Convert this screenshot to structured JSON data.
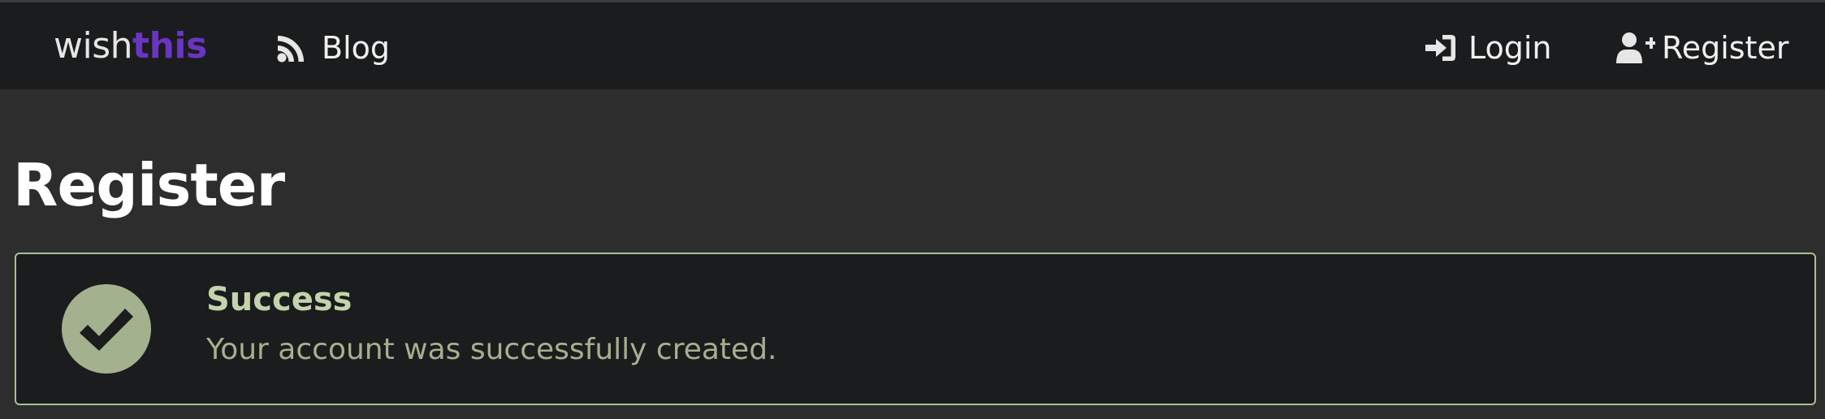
{
  "navbar": {
    "brand_part1": "wish",
    "brand_part2": "this",
    "blog_label": "Blog",
    "login_label": "Login",
    "register_label": "Register",
    "brand_accent_color": "#6a35c3",
    "icons": {
      "blog": "rss-icon",
      "login": "sign-in-icon",
      "register": "user-plus-icon"
    }
  },
  "page": {
    "title": "Register"
  },
  "message": {
    "type": "success",
    "icon": "check-circle-icon",
    "header": "Success",
    "text": "Your account was successfully created.",
    "color": "#a3b18f"
  }
}
